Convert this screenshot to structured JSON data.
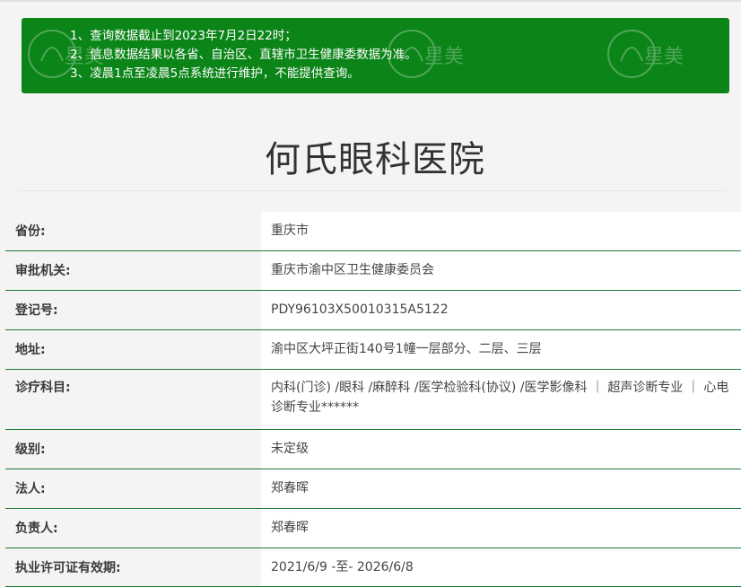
{
  "notice": {
    "lines": [
      "1、查询数据截止到2023年7月2日22时；",
      "2、信息数据结果以各省、自治区、直辖市卫生健康委数据为准。",
      "3、凌晨1点至凌晨5点系统进行维护，不能提供查询。"
    ],
    "watermark_text": "星美",
    "bg_color": "#0b8418"
  },
  "hospital": {
    "name": "何氏眼科医院"
  },
  "details": [
    {
      "label": "省份:",
      "value": "重庆市"
    },
    {
      "label": "审批机关:",
      "value": "重庆市渝中区卫生健康委员会"
    },
    {
      "label": "登记号:",
      "value": "PDY96103X50010315A5122"
    },
    {
      "label": "地址:",
      "value": "渝中区大坪正街140号1幢一层部分、二层、三层"
    },
    {
      "label": "诊疗科目:",
      "value": "内科(门诊) /眼科 /麻醉科 /医学检验科(协议) /医学影像科 ｜ 超声诊断专业 ｜ 心电诊断专业******"
    },
    {
      "label": "级别:",
      "value": "未定级"
    },
    {
      "label": "法人:",
      "value": "郑春晖"
    },
    {
      "label": "负责人:",
      "value": "郑春晖"
    },
    {
      "label": "执业许可证有效期:",
      "value": "2021/6/9 -至- 2026/6/8"
    }
  ],
  "colors": {
    "row_divider": "#1f7a34",
    "label_bg": "#f4f4f4",
    "value_bg": "#ffffff"
  }
}
